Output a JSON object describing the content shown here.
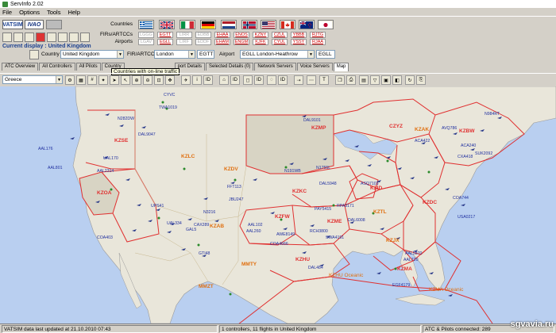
{
  "window": {
    "title": "ServInfo 2.02"
  },
  "menu": [
    "File",
    "Options",
    "Tools",
    "Help"
  ],
  "networks": {
    "vatsim": "VATSIM",
    "ivao": "IVAO"
  },
  "row_labels": {
    "countries": "Countries",
    "firs": "FIRs/ARTCCs",
    "airports": "Airports"
  },
  "flags": [
    "greece",
    "italy",
    "germany",
    "netherlands",
    "norway",
    "usa",
    "canada",
    "new-zealand",
    "japan"
  ],
  "fir_codes": [
    {
      "fir": "LGGG",
      "apt": "LGAV",
      "active": false
    },
    {
      "fir": "EGTT",
      "apt": "EGLL",
      "active": true
    },
    {
      "fir": "LIRR",
      "apt": "LIRF",
      "active": false
    },
    {
      "fir": "EDBB",
      "apt": "EDDF",
      "active": false
    },
    {
      "fir": "EHAA",
      "apt": "EHAM",
      "active": true
    },
    {
      "fir": "ENOS",
      "apt": "ENGM",
      "active": true
    },
    {
      "fir": "KZNY",
      "apt": "KJFK",
      "active": true
    },
    {
      "fir": "CZUL",
      "apt": "CYUL",
      "active": true
    },
    {
      "fir": "YBBB",
      "apt": "YSSY",
      "active": true
    },
    {
      "fir": "RJTG",
      "apt": "RJAA",
      "active": true
    }
  ],
  "current_display": {
    "label": "Current display :",
    "value": "United Kingdom"
  },
  "selectors": {
    "country_label": "Country",
    "country_value": "United Kingdom",
    "fir_label": "FIR/ARTCC",
    "fir_value": "London",
    "fir_code": "EGTT",
    "airport_label": "Airport",
    "airport_value": "EGLL London-Heathrow",
    "airport_code": "EGLL"
  },
  "tabs": [
    {
      "label": "ATC Overview",
      "active": false
    },
    {
      "label": "All Controllers",
      "active": false
    },
    {
      "label": "All Pilots",
      "active": false
    },
    {
      "label": "Country",
      "active": false
    },
    {
      "label": "port Details",
      "active": false
    },
    {
      "label": "Selected Details (0)",
      "active": false
    },
    {
      "label": "Network Servers",
      "active": false
    },
    {
      "label": "Voice Servers",
      "active": false
    },
    {
      "label": "Map",
      "active": true
    }
  ],
  "tooltip": "Countries with on-line traffic",
  "map_region": "Greece",
  "map_labels": {
    "firs": [
      "KZSE",
      "KZLC",
      "KZDV",
      "KZMP",
      "CZYZ",
      "KZBW",
      "KZOA",
      "KZAB",
      "KZKC",
      "KZFW",
      "KZME",
      "KZID",
      "KZTL",
      "KZDC",
      "KZJX",
      "KZHU",
      "KZMA",
      "KZAK",
      "MMTY",
      "MMZT"
    ],
    "oceanic": [
      "KZHU Oceanic",
      "KZMA Oceanic"
    ],
    "callsigns": [
      "N282DW",
      "AAL176",
      "AAL801",
      "DAL9047",
      "UAL170",
      "AAL2314",
      "DAL9101",
      "CYVC",
      "TWA1019",
      "N191WB",
      "N1755L",
      "DAL5948",
      "FFT113",
      "JBU247",
      "AAL102",
      "AAL260",
      "AWE8149",
      "RCH3800",
      "SWA4191",
      "COA4666",
      "DAL484",
      "PAY5415",
      "RPA3171",
      "DAL6008",
      "COA403",
      "ASQ7103",
      "N984RT",
      "AVQ786",
      "ACA422",
      "ACA240",
      "CXA418",
      "SUK2092",
      "AAL5870",
      "AAL720",
      "COA744",
      "USA0217",
      "EGF4179",
      "UAL334",
      "GAL5",
      "GTI48",
      "CAX289",
      "UPS41",
      "N3216"
    ]
  },
  "status": {
    "updated": "VATSIM data last updated at 21.10.2010 07:43",
    "controllers": "1 controllers, 11 flights in United Kingdom",
    "connected": "ATC & Pilots connected: 289"
  },
  "watermark": "sgvavia.ru",
  "colors": {
    "land": "#e9e6da",
    "ocean": "#b9cff0",
    "fir_border": "#e03030",
    "label": "#e07010",
    "callsign": "#2030a0"
  }
}
